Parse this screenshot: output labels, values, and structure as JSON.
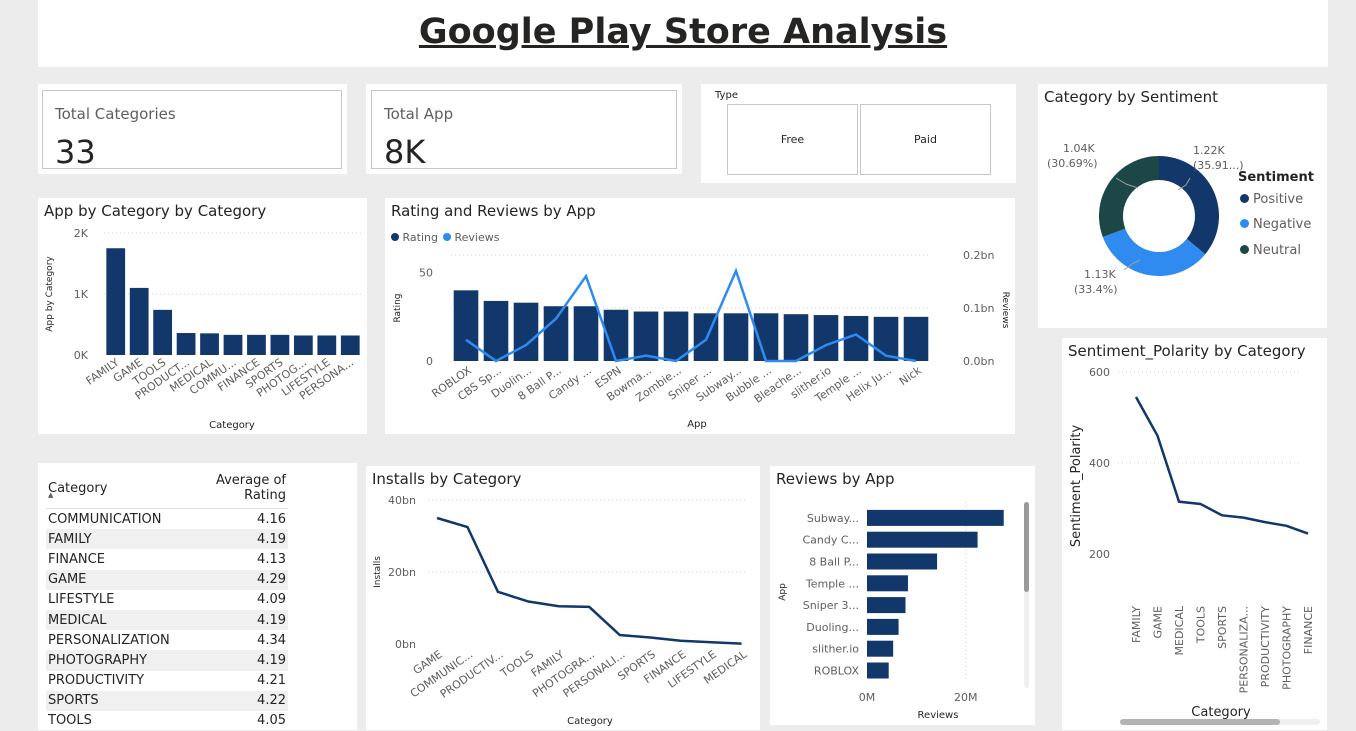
{
  "header": {
    "title": "Google Play Store Analysis "
  },
  "cards": {
    "total_categories": {
      "label": "Total Categories",
      "value": "33"
    },
    "total_app": {
      "label": "Total App",
      "value": "8K"
    }
  },
  "type_slicer": {
    "title": "Type",
    "options": [
      "Free",
      "Paid"
    ]
  },
  "colors": {
    "primary": "#12376b",
    "light_blue": "#2f8bf0",
    "neutral": "#1c4746",
    "background": "#ececec"
  },
  "sentiment": {
    "title": "Category by Sentiment",
    "legend_title": "Sentiment",
    "labels": {
      "neutral": [
        "1.04K",
        "(30.69%)"
      ],
      "positive": [
        "1.22K",
        "(35.91...)"
      ],
      "negative": [
        "1.13K",
        "(33.4%)"
      ]
    },
    "chart_data": {
      "type": "pie",
      "categories": [
        "Positive",
        "Negative",
        "Neutral"
      ],
      "values": [
        1220,
        1130,
        1040
      ],
      "colors": [
        "#12376b",
        "#2f8bf0",
        "#1c4746"
      ]
    }
  },
  "app_by_category": {
    "title": "App by Category by Category",
    "chart_data": {
      "type": "bar",
      "categories": [
        "FAMILY",
        "GAME",
        "TOOLS",
        "PRODUCT...",
        "MEDICAL",
        "COMMU...",
        "FINANCE",
        "SPORTS",
        "PHOTOG...",
        "LIFESTYLE",
        "PERSONA..."
      ],
      "values": [
        1750,
        1100,
        740,
        360,
        355,
        330,
        330,
        330,
        320,
        320,
        320
      ],
      "xlabel": "Category",
      "ylabel": "App by Category",
      "yticks": [
        "0K",
        "1K",
        "2K"
      ],
      "ylim": [
        0,
        2000
      ]
    }
  },
  "rating_reviews": {
    "title": "Rating and Reviews by App",
    "legend": [
      "Rating",
      "Reviews"
    ],
    "chart_data": {
      "type": "bar",
      "categories": [
        "ROBLOX",
        "CBS Sp...",
        "Duolin...",
        "8 Ball P...",
        "Candy ...",
        "ESPN",
        "Bowma...",
        "Zombie...",
        "Sniper ...",
        "Subway...",
        "Bubble ...",
        "Bleache...",
        "slither.io",
        "Temple ...",
        "Helix Ju...",
        "Nick"
      ],
      "series": [
        {
          "name": "Rating",
          "axis": "left",
          "values": [
            40,
            34,
            33,
            31,
            31,
            29,
            28,
            28,
            27,
            27,
            27,
            26.5,
            26,
            25.5,
            25,
            25
          ]
        },
        {
          "name": "Reviews",
          "axis": "right",
          "values": [
            0.04,
            0.0,
            0.03,
            0.08,
            0.16,
            0.0,
            0.01,
            0.0,
            0.04,
            0.17,
            0.0,
            0.0,
            0.03,
            0.05,
            0.01,
            0.0
          ]
        }
      ],
      "xlabel": "App",
      "ylabel": "Rating",
      "y2label": "Reviews",
      "yticks": [
        "0",
        "50"
      ],
      "y2ticks": [
        "0.0bn",
        "0.1bn",
        "0.2bn"
      ],
      "ylim": [
        0,
        60
      ],
      "y2lim": [
        0,
        0.2
      ]
    }
  },
  "rating_table": {
    "columns": [
      "Category",
      "Average of Rating"
    ],
    "rows": [
      [
        "COMMUNICATION",
        "4.16"
      ],
      [
        "FAMILY",
        "4.19"
      ],
      [
        "FINANCE",
        "4.13"
      ],
      [
        "GAME",
        "4.29"
      ],
      [
        "LIFESTYLE",
        "4.09"
      ],
      [
        "MEDICAL",
        "4.19"
      ],
      [
        "PERSONALIZATION",
        "4.34"
      ],
      [
        "PHOTOGRAPHY",
        "4.19"
      ],
      [
        "PRODUCTIVITY",
        "4.21"
      ],
      [
        "SPORTS",
        "4.22"
      ],
      [
        "TOOLS",
        "4.05"
      ]
    ]
  },
  "installs": {
    "title": "Installs by Category",
    "chart_data": {
      "type": "line",
      "categories": [
        "GAME",
        "COMMUNIC...",
        "PRODUCTIV...",
        "TOOLS",
        "FAMILY",
        "PHOTOGRA...",
        "PERSONALI...",
        "SPORTS",
        "FINANCE",
        "LIFESTYLE",
        "MEDICAL"
      ],
      "values": [
        35,
        32.5,
        14.5,
        11.8,
        10.5,
        10.3,
        2.5,
        1.8,
        0.9,
        0.5,
        0.1
      ],
      "xlabel": "Category",
      "ylabel": "Installs",
      "yticks": [
        "0bn",
        "20bn",
        "40bn"
      ],
      "ylim": [
        0,
        40
      ]
    }
  },
  "reviews_by_app": {
    "title": "Reviews by App",
    "chart_data": {
      "type": "bar",
      "orientation": "horizontal",
      "categories": [
        "Subway...",
        "Candy C...",
        "8 Ball P...",
        "Temple ...",
        "Sniper 3...",
        "Duoling...",
        "slither.io",
        "ROBLOX"
      ],
      "values": [
        27.7,
        22.4,
        14.2,
        8.3,
        7.8,
        6.4,
        5.3,
        4.4
      ],
      "xlabel": "Reviews",
      "ylabel": "App",
      "xticks": [
        "0M",
        "20M"
      ],
      "xlim": [
        0,
        30
      ]
    }
  },
  "polarity": {
    "title": "Sentiment_Polarity by Category",
    "chart_data": {
      "type": "line",
      "categories": [
        "FAMILY",
        "GAME",
        "MEDICAL",
        "TOOLS",
        "SPORTS",
        "PERSONALIZA...",
        "PRODUCTIVITY",
        "PHOTOGRAPHY",
        "FINANCE"
      ],
      "values": [
        545,
        460,
        315,
        310,
        285,
        280,
        270,
        262,
        245
      ],
      "xlabel": "Category",
      "ylabel": "Sentiment_Polarity",
      "yticks": [
        "200",
        "400",
        "600"
      ],
      "ylim": [
        200,
        600
      ]
    }
  }
}
